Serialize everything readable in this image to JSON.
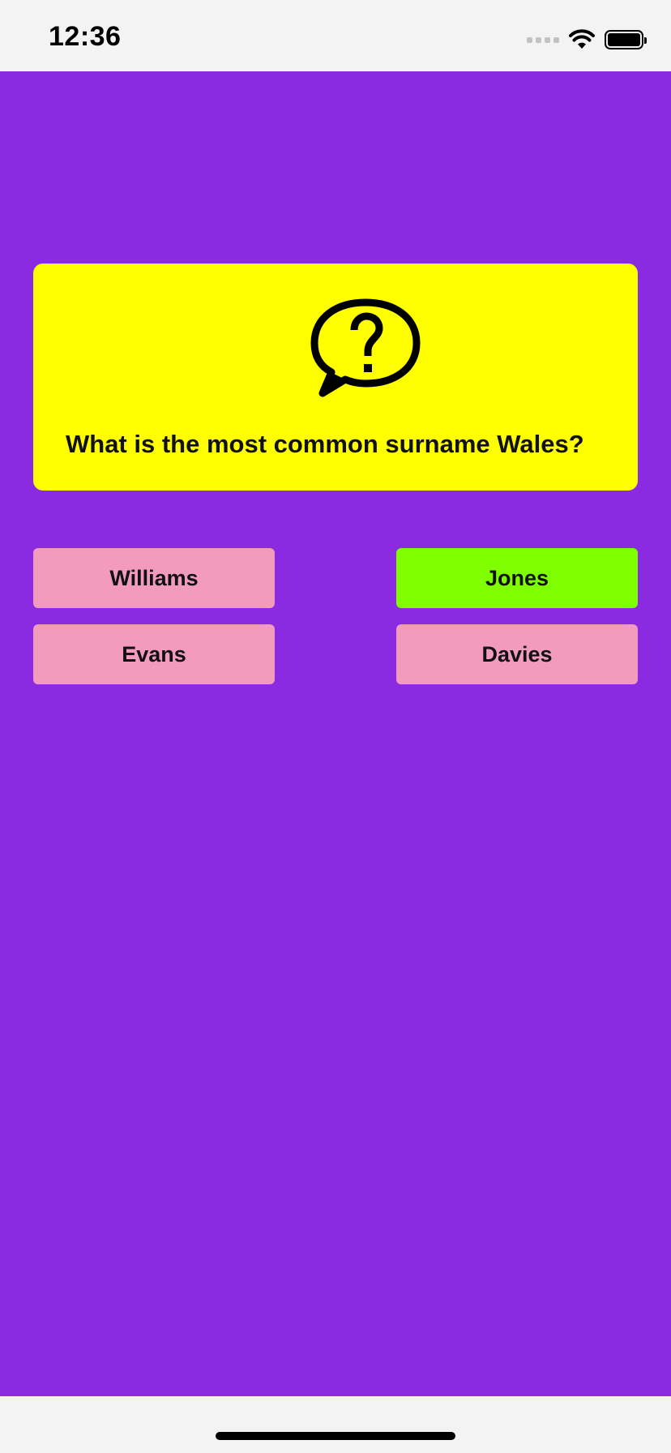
{
  "status_bar": {
    "time": "12:36",
    "icons": [
      "signal-dots-icon",
      "wifi-icon",
      "battery-icon"
    ]
  },
  "colors": {
    "background": "#8a2be2",
    "card": "#ffff00",
    "answer_default": "#f29bbc",
    "answer_correct": "#7fff00"
  },
  "question": {
    "icon": "question-speech-bubble-icon",
    "text": "What is the most common surname Wales?"
  },
  "answers": [
    {
      "label": "Williams",
      "state": "default"
    },
    {
      "label": "Jones",
      "state": "correct"
    },
    {
      "label": "Evans",
      "state": "default"
    },
    {
      "label": "Davies",
      "state": "default"
    }
  ]
}
